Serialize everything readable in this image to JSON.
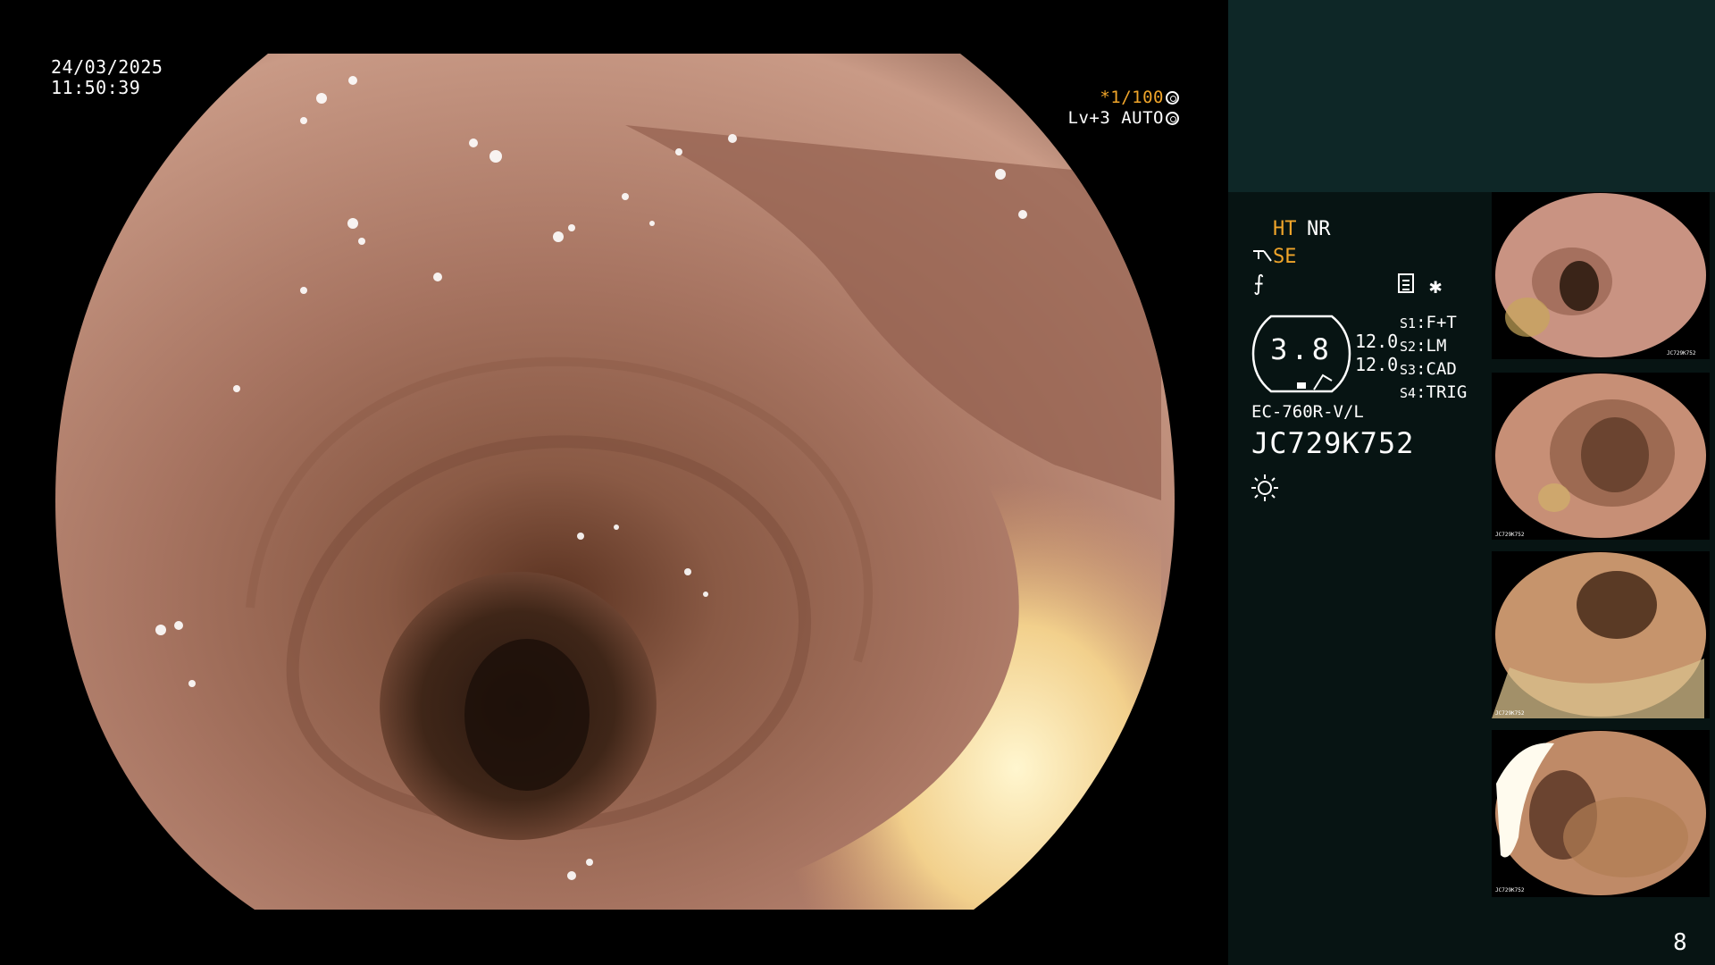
{
  "main_view": {
    "date": "24/03/2025",
    "time": "11:50:39",
    "shutter_mark": "*",
    "shutter_value": "1/100",
    "iris_label": "Lv+3 AUTO"
  },
  "panel": {
    "ht_label": "HT",
    "nr_label": "NR",
    "se_label": "SE",
    "gauge_value": "3.8",
    "gauge_left_top": "12.0",
    "gauge_left_bottom": "12.0",
    "switches": [
      {
        "key": "S1",
        "value": "F+T"
      },
      {
        "key": "S2",
        "value": "LM"
      },
      {
        "key": "S3",
        "value": "CAD"
      },
      {
        "key": "S4",
        "value": "TRIG"
      }
    ],
    "scope_model": "EC-760R-V/L",
    "scope_serial": "JC729K752",
    "page_number": "8",
    "icons": [
      "scissor-hose-icon",
      "f-symbol-icon",
      "list-settings-icon",
      "star-icon",
      "light-source-icon"
    ]
  },
  "thumbnails": [
    {
      "label": "JC729K752"
    },
    {
      "label": "JC729K752"
    },
    {
      "label": "JC729K752"
    },
    {
      "label": "JC729K752"
    }
  ],
  "colors": {
    "accent": "#f0a52a",
    "panel_bg": "#071413",
    "panel_top_bg": "#0e2727",
    "mucosa": "#b8826e"
  }
}
